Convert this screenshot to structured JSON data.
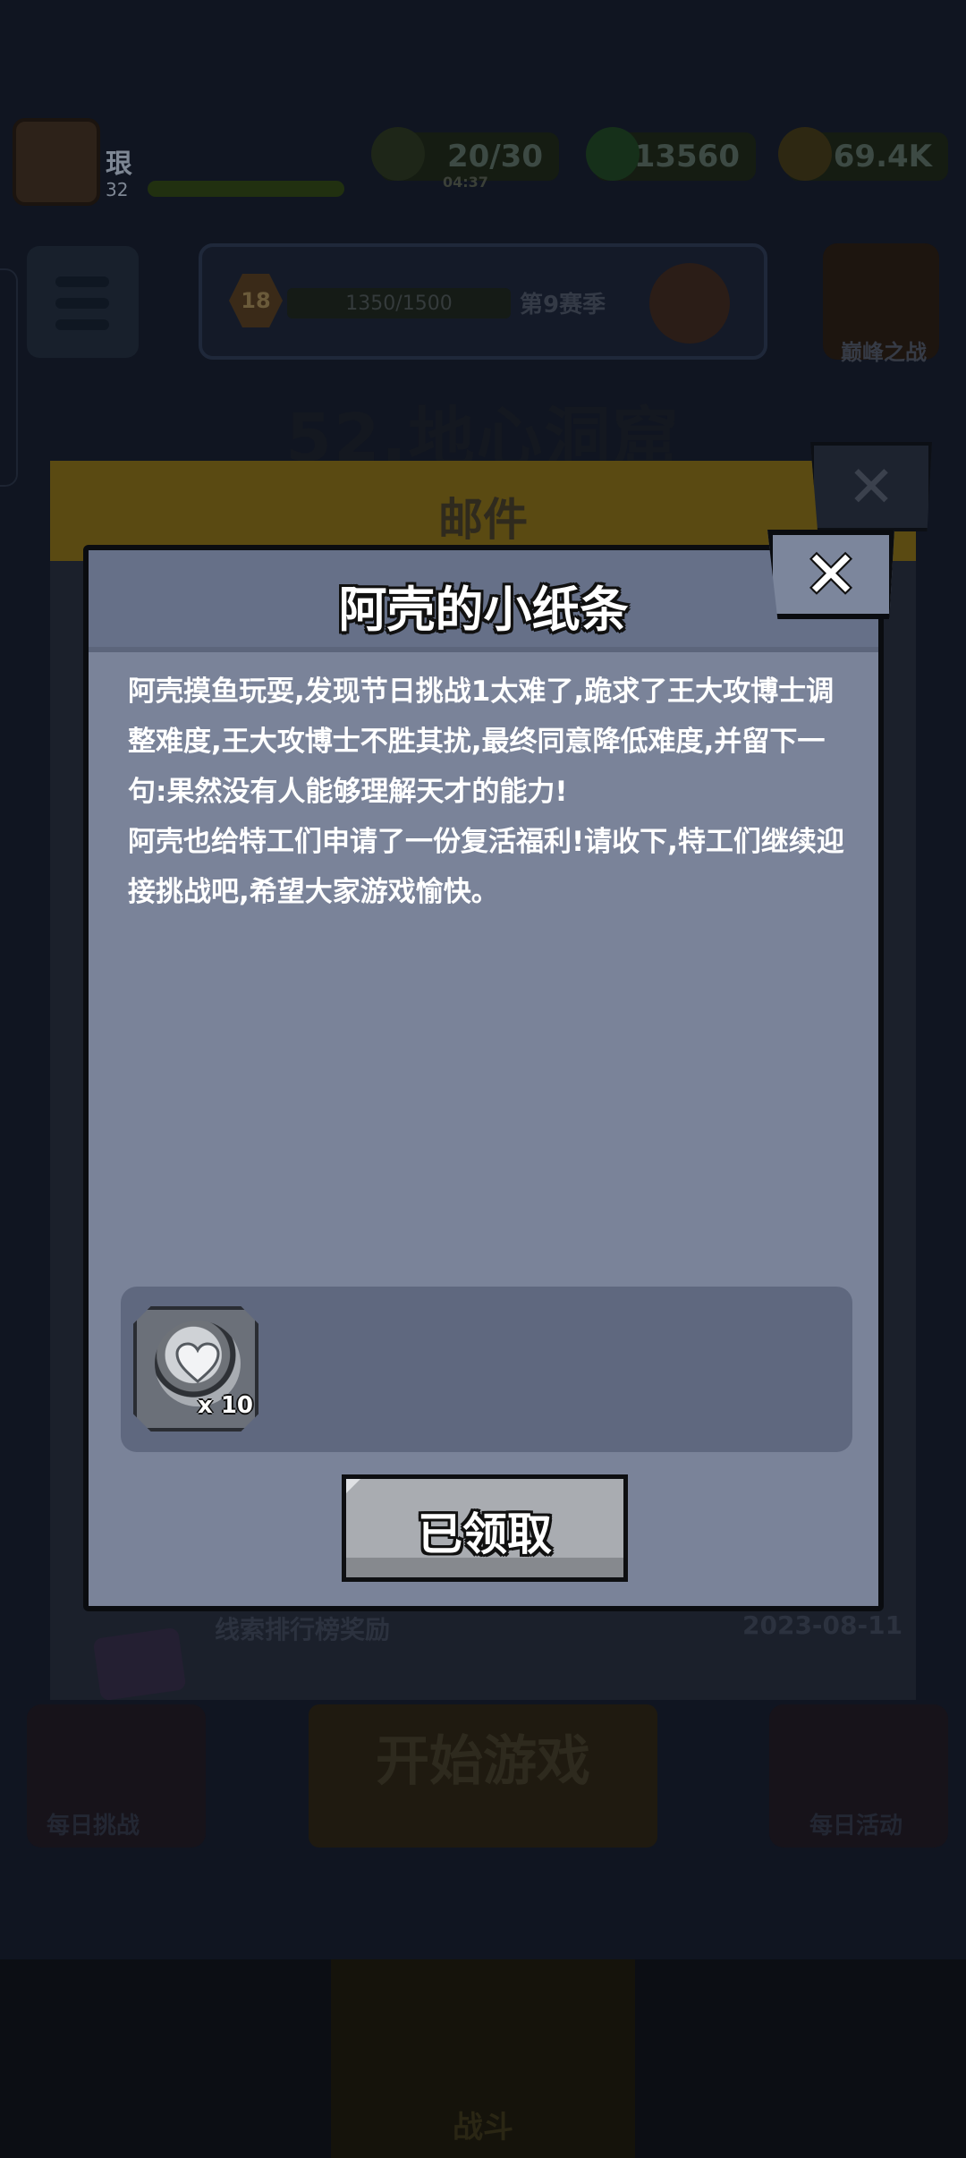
{
  "hud": {
    "player_name": "珢",
    "player_level": "32",
    "stamina": "20/30",
    "stamina_timer": "04:37",
    "gems": "13560",
    "coins": "69.4K"
  },
  "rank": {
    "badge_level": "18",
    "progress": "1350/1500",
    "season": "第9赛季",
    "right_button_label": "巅峰之战"
  },
  "stage_title": "52.地心洞窟",
  "mail": {
    "title": "邮件",
    "close_glyph": "✕",
    "row_title": "线索排行榜奖励",
    "row_date": "2023-08-11"
  },
  "bottom": {
    "daily_challenge": "每日挑战",
    "start_game": "开始游戏",
    "daily_event": "每日活动",
    "battle": "战斗"
  },
  "letter": {
    "title": "阿壳的小纸条",
    "paragraph1": "阿壳摸鱼玩耍,发现节日挑战1太难了,跪求了王大攻博士调整难度,王大攻博士不胜其扰,最终同意降低难度,并留下一句:果然没有人能够理解天才的能力!",
    "paragraph2": "阿壳也给特工们申请了一份复活福利!请收下,特工们继续迎接挑战吧,希望大家游戏愉快。",
    "reward_icon": "heart-revive-icon",
    "reward_count": "x 10",
    "claim_label": "已领取",
    "close_glyph": "✕"
  },
  "colors": {
    "dialog_bg": "#7a8399",
    "dialog_header": "#667088",
    "reward_box": "#5f687f",
    "claim_button": "#a9acb1"
  }
}
